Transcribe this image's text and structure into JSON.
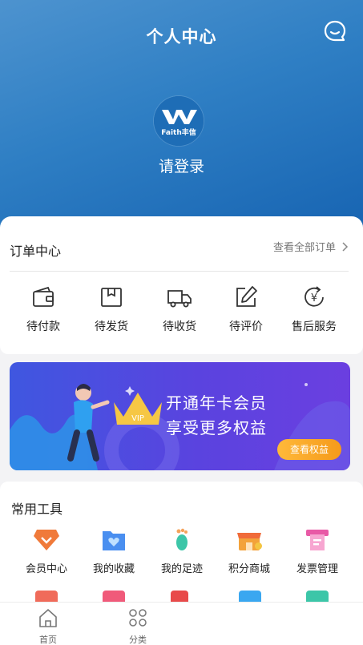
{
  "header": {
    "title": "个人中心",
    "login_label": "请登录",
    "logo_text": "Faith丰信",
    "gradient": [
      "#4d93cf",
      "#1764b2"
    ]
  },
  "orders": {
    "title": "订单中心",
    "view_all": "查看全部订单",
    "items": [
      {
        "label": "待付款",
        "icon": "wallet-icon"
      },
      {
        "label": "待发货",
        "icon": "package-icon"
      },
      {
        "label": "待收货",
        "icon": "truck-icon"
      },
      {
        "label": "待评价",
        "icon": "edit-icon"
      },
      {
        "label": "售后服务",
        "icon": "refund-icon"
      }
    ]
  },
  "banner": {
    "line1": "开通年卡会员",
    "line2": "享受更多权益",
    "button": "查看权益",
    "crown_text": "VIP"
  },
  "tools": {
    "title": "常用工具",
    "items": [
      {
        "label": "会员中心",
        "icon": "member-diamond-icon",
        "color": "#f07a3a"
      },
      {
        "label": "我的收藏",
        "icon": "folder-heart-icon",
        "color": "#4a8ff0"
      },
      {
        "label": "我的足迹",
        "icon": "footprint-icon",
        "color": "#3cc6a8"
      },
      {
        "label": "积分商城",
        "icon": "store-icon",
        "color": "#f3a23a"
      },
      {
        "label": "发票管理",
        "icon": "invoice-icon",
        "color": "#e85aa6"
      }
    ]
  },
  "tabbar": {
    "items": [
      {
        "label": "首页",
        "icon": "home-icon"
      },
      {
        "label": "分类",
        "icon": "category-icon"
      }
    ]
  }
}
